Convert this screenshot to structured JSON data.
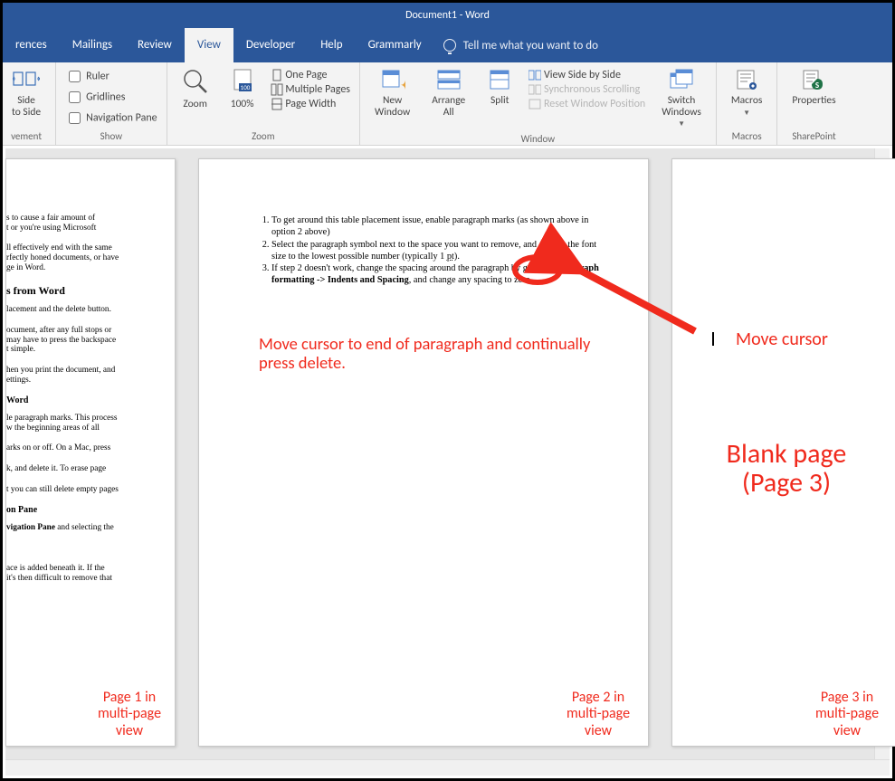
{
  "title": "Document1  -  Word",
  "tabs": {
    "references": "rences",
    "mailings": "Mailings",
    "review": "Review",
    "view": "View",
    "developer": "Developer",
    "help": "Help",
    "grammarly": "Grammarly",
    "tellme": "Tell me what you want to do"
  },
  "ribbon": {
    "views": {
      "side": "Side",
      "toside": "to Side",
      "vement": "vement"
    },
    "show": {
      "ruler": "Ruler",
      "gridlines": "Gridlines",
      "navpane": "Navigation Pane",
      "group": "Show"
    },
    "zoom": {
      "zoom": "Zoom",
      "p100": "100%",
      "onepage": "One Page",
      "multipages": "Multiple Pages",
      "pagewidth": "Page Width",
      "group": "Zoom"
    },
    "window": {
      "newwindow": "New\nWindow",
      "arrangeall": "Arrange\nAll",
      "split": "Split",
      "sidebyside": "View Side by Side",
      "syncscroll": "Synchronous Scrolling",
      "resetpos": "Reset Window Position",
      "switch": "Switch\nWindows",
      "group": "Window"
    },
    "macros": {
      "macros": "Macros",
      "group": "Macros"
    },
    "sharepoint": {
      "properties": "Properties",
      "group": "SharePoint"
    }
  },
  "page1": {
    "l1": "s to cause a fair amount of",
    "l2": "t or you're using Microsoft",
    "l3": "ll effectively end with the same",
    "l4": "rfectly honed documents, or have",
    "l5": "ge in Word.",
    "h1": "s from Word",
    "l6": "lacement and the delete button.",
    "l7": "ocument, after any full stops or",
    "l8": "may have to press the backspace",
    "l9": "t simple.",
    "l10": "hen you print the document, and",
    "l11": "ettings.",
    "h2": "Word",
    "l12": "le paragraph marks. This process",
    "l13": "w the beginning areas of all",
    "l14": "arks on or off. On a Mac, press",
    "l15": "k, and delete it. To erase page",
    "l16": "t you can still delete empty pages",
    "h3": "on Pane",
    "l17a": "vigation Pane",
    "l17b": " and selecting the",
    "l18": "ace is added beneath it. If the",
    "l19": "it's then difficult to remove that"
  },
  "page2": {
    "li1": "To get around this table placement issue, enable paragraph marks (as shown above in option 2 above)",
    "li2a": "Select the paragraph symbol next to the space you want to remove, and change the font size to the lowest possible number (typically 1 ",
    "li2pt": "pt",
    "li2b": ").",
    "li3a": "If step 2 doesn't work, change the spacing around the paragraph by going to ",
    "li3b": "Paragraph formatting -> Indents and Spacing",
    "li3c": ", and change any spacing to zero."
  },
  "annot": {
    "instr": "Move cursor to end of paragraph and continually press delete.",
    "movecursor": "Move cursor",
    "blank": "Blank page\n(Page 3)",
    "p1": "Page 1 in\nmulti-page\nview",
    "p2": "Page 2 in\nmulti-page\nview",
    "p3": "Page 3 in\nmulti-page\nview"
  }
}
